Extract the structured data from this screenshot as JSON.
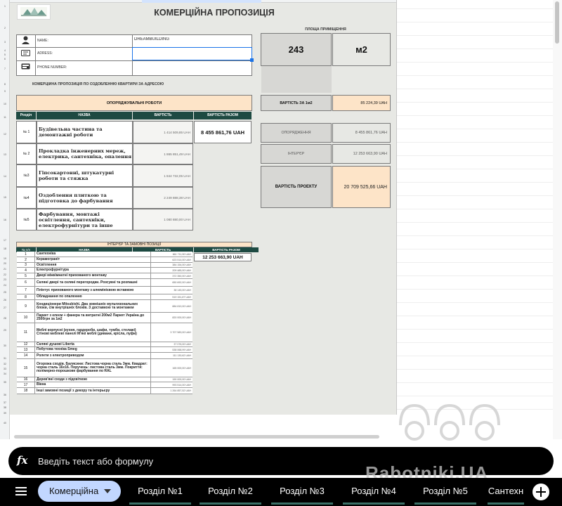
{
  "sheet": {
    "title": "КОМЕРЦІЙНА ПРОПОЗИЦІЯ",
    "info": {
      "name_label": "NAME:",
      "name_value": "DREAMBUILDING",
      "adress_label": "ADRESS:",
      "adress_value": "",
      "phone_label": "PHONE NUMBER:",
      "phone_value": ""
    },
    "proposal_text": "КОМЕРЦІЙНА ПРОПОЗИЦІЯ ПО ОЗДОБЛЕННЮ КВАРТИРИ ЗА АДРЕСОЮ",
    "area": {
      "label": "ПЛОЩА ПРИМІЩЕННЯ",
      "value": "243",
      "unit": "м2"
    },
    "price_per_m2": {
      "label": "ВАРТІСТЬ ЗА 1м2",
      "value": "85 224,39 UAH"
    },
    "summary": [
      {
        "label": "ОПОРЯДЖЕННЯ",
        "value": "8 455 861,76 UAH"
      },
      {
        "label": "ІНТЕР'ЄР",
        "value": "12 253 663,90 UAH"
      }
    ],
    "project_total": {
      "label": "ВАРТІСТЬ ПРОЕКТУ",
      "value": "20 709 525,66 UAH"
    },
    "finishing": {
      "section_label": "ОПОРЯДЖУВАЛЬНІ РОБОТИ",
      "headers": [
        "Розділ",
        "НАЗВА",
        "ВАРТІСТЬ",
        "ВАРТІСТЬ РАЗОМ"
      ],
      "total": "8 455 861,76 UAH",
      "rows": [
        {
          "n": "№ 1",
          "name": "Будівельна частина та демонтажні роботи",
          "value": "1 414 509,85 UAH"
        },
        {
          "n": "№ 2",
          "name": "Прокладка інженерних мереж, електрика, сантехніка, опалення",
          "value": "1 865 851,49 UAH"
        },
        {
          "n": "№3",
          "name": "Гіпсокартонні, штукатурні роботи та стяжка",
          "value": "1 844 732,05 UAH"
        },
        {
          "n": "№4",
          "name": "Оздоблення плиткою та підготовка до фарбування",
          "value": "2 249 888,38 UAH"
        },
        {
          "n": "№5",
          "name": "Фарбування, монтажі освітлення, сантехніки, електрофурнітури та інше",
          "value": "1 080 880,00 UAH"
        }
      ]
    },
    "interior": {
      "section_label": "ІНТЕР'ЄР ТА ЗАМОВНІ ПОЗИЦІЇ",
      "headers": [
        "№ п/п",
        "НАЗВА",
        "ВАРТІСТЬ",
        "ВАРТІСТЬ РАЗОМ"
      ],
      "total": "12 253 663,90 UAH",
      "rows": [
        {
          "n": "1",
          "name": "Сантехніка",
          "value": "661 711,90 UAH"
        },
        {
          "n": "2",
          "name": "Керамограніт",
          "value": "623 514,00 UAH"
        },
        {
          "n": "3",
          "name": "Освітлення",
          "value": "384 154,00 UAH"
        },
        {
          "n": "4",
          "name": "Електрофурнітура",
          "value": "209 485,00 UAH"
        },
        {
          "n": "5",
          "name": "Двері міжкімнатні прихованого монтажу",
          "value": "372 350,00 UAH"
        },
        {
          "n": "6",
          "name": "Скляні двері та скляні перегородки. Розсувні та розпашні",
          "value": "650 692,00 UAH"
        },
        {
          "n": "7",
          "name": "Плінтус прихованого монтажу з алюмінієвою вставкою",
          "value": "38 145,00 UAH"
        },
        {
          "n": "8",
          "name": "Обладнання по опаленню",
          "value": "519 151,87 UAH"
        },
        {
          "n": "9",
          "name": "Кондиціонери Mitsubishi. Два зовнішніх мультизональних блоки, сім внутрішніх блоків. З доставкою та монтажем",
          "value": "884 810,00 UAH"
        },
        {
          "n": "10",
          "name": "Паркет з клеєм + фанера та витратні 200м2 Паркет Україна до 2500грн за 1м2",
          "value": "820 000,00 UAH"
        },
        {
          "n": "11",
          "name": "Меблі корпусні (кухня, гардероби, шафи, тумби, стелажі) Стінові меблеві панелі М'які меблі (дивани, крісла, пуфи)",
          "value": "3 707 583,00 UAH"
        },
        {
          "n": "12",
          "name": "Скляні душові Liberta",
          "value": "37 076,00 UAH"
        },
        {
          "n": "13",
          "name": "Побутова техніка Smeg",
          "value": "538 068,99 UAH"
        },
        {
          "n": "14",
          "name": "Ролети з електроприводом",
          "value": "111 130,62 UAH"
        },
        {
          "n": "15",
          "name": "Огорожа сходів. Балясини: Листова чорна сталь 3мм. Квадрат: чорна сталь 16х16. Поручень: листова сталь 3мм. Покриття: полімерно-порошкове фарбування по RAL",
          "value": "165 000,00 UAH"
        },
        {
          "n": "16",
          "name": "Дерев'яні сходи з підсвіткою",
          "value": "190 000,00 UAH"
        },
        {
          "n": "17",
          "name": "Вікна",
          "value": "993 514,00 UAH"
        },
        {
          "n": "18",
          "name": "Інші замовні позиції з декору та інтерьєру",
          "value": "1 264 857,52 UAH"
        }
      ]
    },
    "row_numbers": [
      "1",
      "2",
      "3",
      "4",
      "5",
      "6",
      "7",
      "8",
      "9",
      "10",
      "11",
      "12",
      "13",
      "14",
      "15",
      "16",
      "17",
      "18",
      "19",
      "20",
      "21",
      "22",
      "23",
      "24",
      "25",
      "26",
      "27",
      "28",
      "29",
      "30",
      "31",
      "32",
      "33",
      "34",
      "35",
      "36",
      "37",
      "38",
      "39",
      "40"
    ]
  },
  "formula_bar": {
    "placeholder": "Введіть текст або формулу",
    "fx": "fx"
  },
  "tabs": {
    "active": "Комерційна",
    "items": [
      "Розділ №1",
      "Розділ №2",
      "Розділ №3",
      "Розділ №4",
      "Розділ №5",
      "Сантехн"
    ]
  },
  "watermark": "Rabotniki.UA",
  "colors": {
    "teal": "#1e4a42",
    "peach": "#fde4c8",
    "active_tab": "#c2d7ff"
  },
  "icons": [
    "person-icon",
    "address-card-icon",
    "phone-card-icon",
    "menu-icon",
    "dropdown-caret-icon",
    "plus-icon"
  ]
}
